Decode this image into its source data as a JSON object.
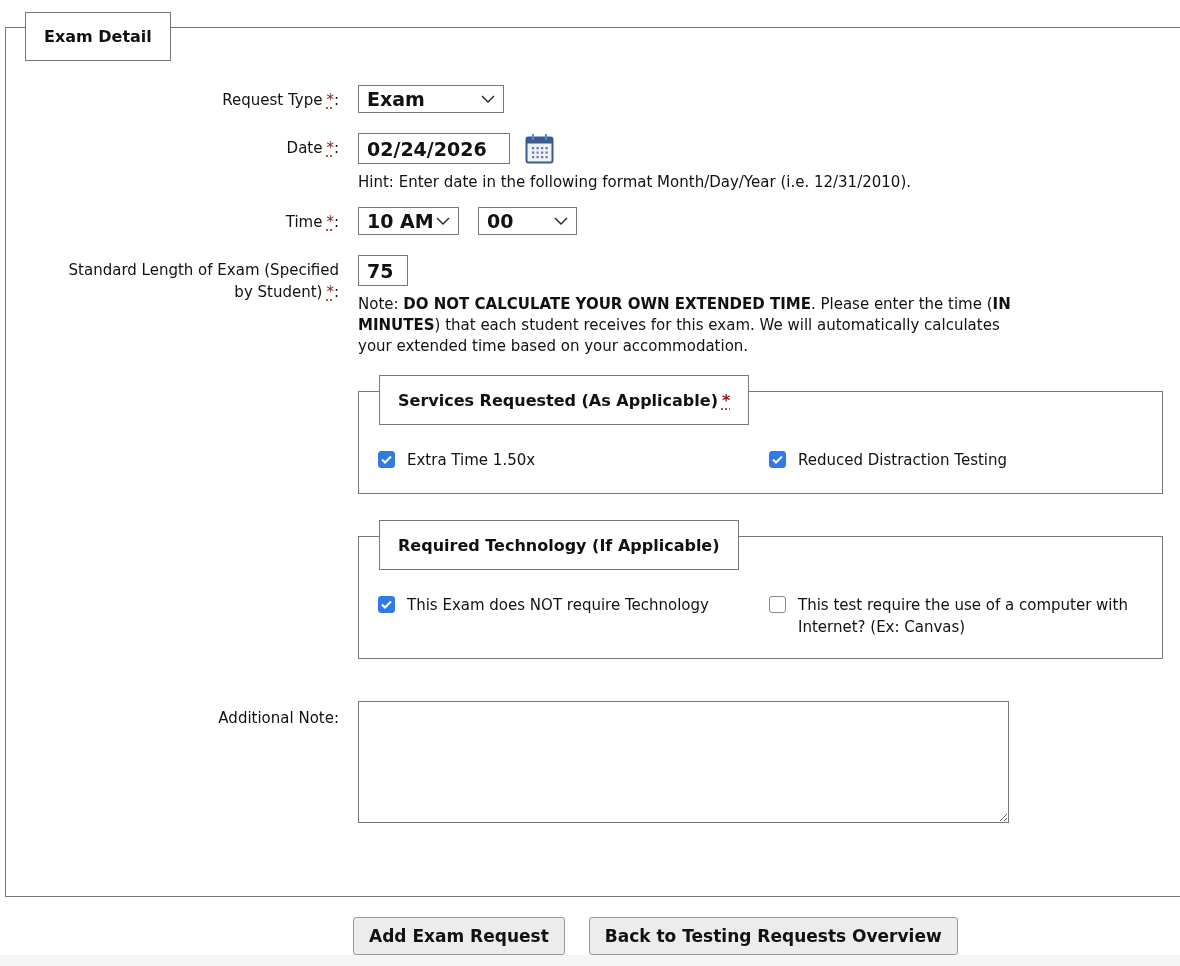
{
  "fieldset": {
    "legend": "Exam Detail"
  },
  "fields": [
    {
      "kind": "select",
      "label": "Request Type",
      "required_mark": "*",
      "separator": ":",
      "value": "Exam"
    },
    {
      "kind": "date",
      "label": "Date",
      "required_mark": "*",
      "separator": ":",
      "value": "02/24/2026",
      "hint": "Hint: Enter date in the following format Month/Day/Year (i.e. 12/31/2010)."
    },
    {
      "kind": "time",
      "label": "Time",
      "required_mark": "*",
      "separator": ":",
      "hour": "10 AM",
      "minute": "00"
    },
    {
      "kind": "number",
      "label": "Standard Length of Exam (Specified by Student)",
      "required_mark": "*",
      "separator": ":",
      "value": "75",
      "note": "Note: **DO NOT CALCULATE YOUR OWN EXTENDED TIME**. Please enter the time (**IN MINUTES**) that each student receives for this exam. We will automatically calculates your extended time based on your accommodation."
    }
  ],
  "groups": [
    {
      "legend": "Services Requested (As Applicable)",
      "required_mark": "*",
      "options": [
        {
          "label": "Extra Time 1.50x",
          "checked": true
        },
        {
          "label": "Reduced Distraction Testing",
          "checked": true
        }
      ]
    },
    {
      "legend": "Required Technology (If Applicable)",
      "options": [
        {
          "label": "This Exam does NOT require Technology",
          "checked": true
        },
        {
          "label": "This test require the use of a computer with Internet? (Ex: Canvas)",
          "checked": false
        }
      ]
    }
  ],
  "additional_note": {
    "label": "Additional Note:"
  },
  "buttons": [
    "Add Exam Request",
    "Back to Testing Requests Overview"
  ]
}
